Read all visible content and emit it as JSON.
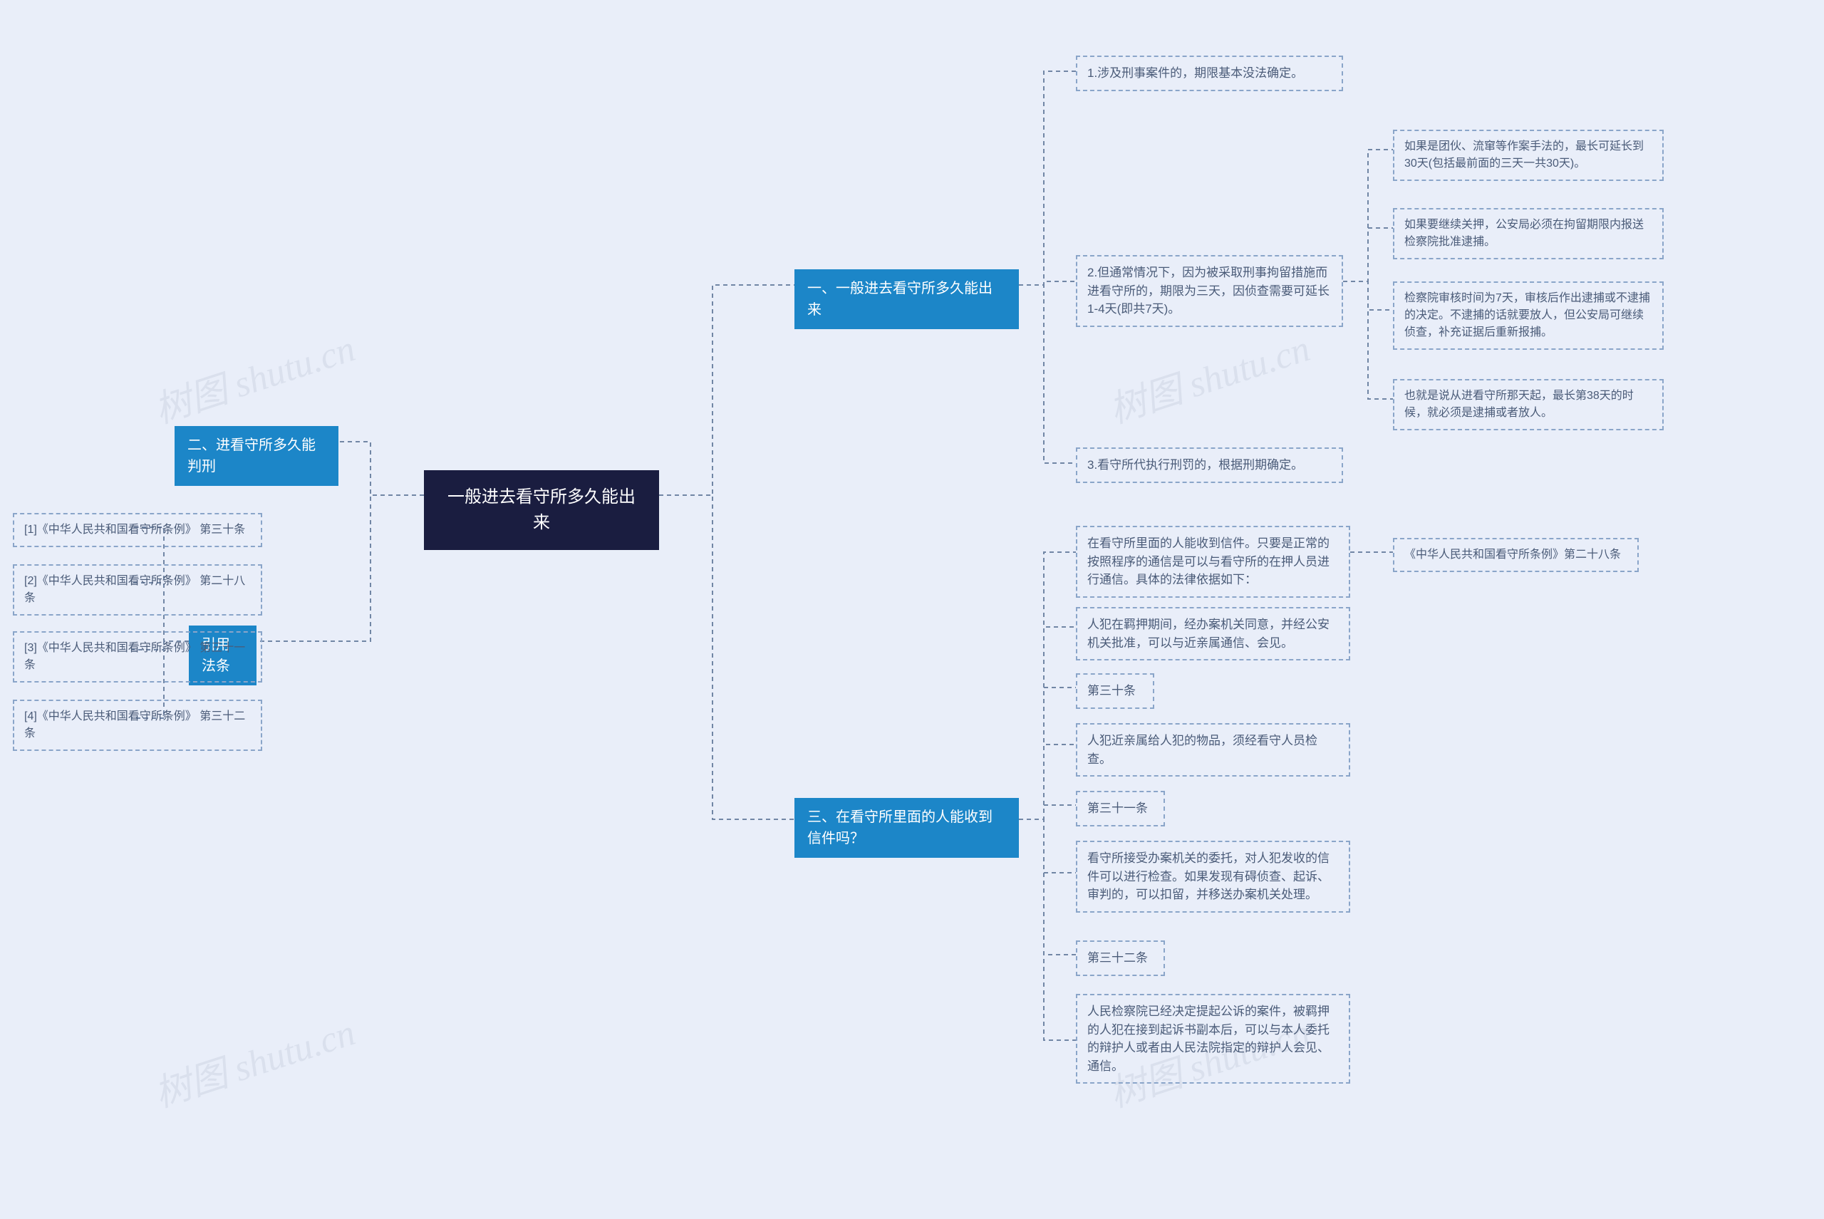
{
  "root": {
    "title": "一般进去看守所多久能出来"
  },
  "branches": {
    "b1": {
      "label": "一、一般进去看守所多久能出来"
    },
    "b2": {
      "label": "二、进看守所多久能判刑"
    },
    "b3": {
      "label": "三、在看守所里面的人能收到信件吗？"
    },
    "b4": {
      "label": "引用法条"
    }
  },
  "b1_leaves": {
    "l1": "1.涉及刑事案件的，期限基本没法确定。",
    "l2": "2.但通常情况下，因为被采取刑事拘留措施而进看守所的，期限为三天，因侦查需要可延长1-4天(即共7天)。",
    "l3": "3.看守所代执行刑罚的，根据刑期确定。",
    "l2_sub": {
      "s1": "如果是团伙、流窜等作案手法的，最长可延长到30天(包括最前面的三天一共30天)。",
      "s2": "如果要继续关押，公安局必须在拘留期限内报送检察院批准逮捕。",
      "s3": "检察院审核时间为7天，审核后作出逮捕或不逮捕的决定。不逮捕的话就要放人，但公安局可继续侦查，补充证据后重新报捕。",
      "s4": "也就是说从进看守所那天起，最长第38天的时候，就必须是逮捕或者放人。"
    }
  },
  "b3_leaves": {
    "l1": "在看守所里面的人能收到信件。只要是正常的按照程序的通信是可以与看守所的在押人员进行通信。具体的法律依据如下：",
    "l1_sub": "《中华人民共和国看守所条例》第二十八条",
    "l2": "人犯在羁押期间，经办案机关同意，并经公安机关批准，可以与近亲属通信、会见。",
    "l3": "第三十条",
    "l4": "人犯近亲属给人犯的物品，须经看守人员检查。",
    "l5": "第三十一条",
    "l6": "看守所接受办案机关的委托，对人犯发收的信件可以进行检查。如果发现有碍侦查、起诉、审判的，可以扣留，并移送办案机关处理。",
    "l7": "第三十二条",
    "l8": "人民检察院已经决定提起公诉的案件，被羁押的人犯在接到起诉书副本后，可以与本人委托的辩护人或者由人民法院指定的辩护人会见、通信。"
  },
  "b4_leaves": {
    "l1": "[1]《中华人民共和国看守所条例》 第三十条",
    "l2": "[2]《中华人民共和国看守所条例》 第二十八条",
    "l3": "[3]《中华人民共和国看守所条例》 第三十一条",
    "l4": "[4]《中华人民共和国看守所条例》 第三十二条"
  },
  "watermark": "树图 shutu.cn"
}
